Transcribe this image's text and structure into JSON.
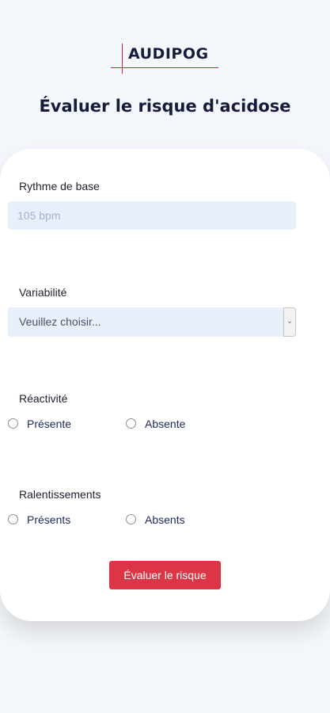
{
  "logo": {
    "text": "AUDIPOG"
  },
  "page_title": "Évaluer le risque d'acidose",
  "form": {
    "rythme": {
      "label": "Rythme de base",
      "placeholder": "105 bpm",
      "value": ""
    },
    "variabilite": {
      "label": "Variabilité",
      "selected": "Veuillez choisir..."
    },
    "reactivite": {
      "label": "Réactivité",
      "options": [
        "Présente",
        "Absente"
      ]
    },
    "ralentissements": {
      "label": "Ralentissements",
      "options": [
        "Présents",
        "Absents"
      ]
    },
    "submit_label": "Évaluer le risque"
  },
  "colors": {
    "accent": "#dc3545",
    "title": "#151b3d",
    "input_bg": "#e8f0fe",
    "page_bg": "#f4f7fb"
  },
  "icons": {
    "caret": "chevron-down-icon",
    "logo_mark": "crosshair-icon"
  }
}
